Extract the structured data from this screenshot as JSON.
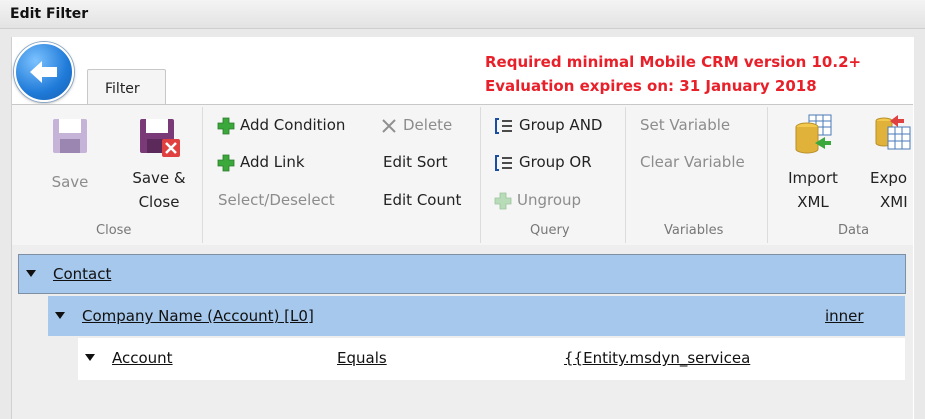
{
  "window": {
    "title": "Edit Filter"
  },
  "tabs": [
    {
      "label": "Filter"
    }
  ],
  "notice": {
    "line1": "Required minimal Mobile CRM version 10.2+",
    "line2": "Evaluation expires on: 31 January 2018"
  },
  "ribbon": {
    "close_group": {
      "label": "Close",
      "save": "Save",
      "save_close_line1": "Save &",
      "save_close_line2": "Close"
    },
    "edit_group": {
      "add_condition": "Add Condition",
      "delete": "Delete",
      "add_link": "Add Link",
      "edit_sort": "Edit Sort",
      "select_deselect": "Select/Deselect",
      "edit_count": "Edit Count"
    },
    "query_group": {
      "label": "Query",
      "group_and": "Group AND",
      "group_or": "Group OR",
      "ungroup": "Ungroup"
    },
    "variables_group": {
      "label": "Variables",
      "set_variable": "Set Variable",
      "clear_variable": "Clear Variable"
    },
    "data_group": {
      "label": "Data",
      "import_line1": "Import",
      "import_line2": "XML",
      "export_line1": "Expo",
      "export_line2": "XMI"
    }
  },
  "tree": {
    "root": {
      "label": "Contact"
    },
    "link": {
      "label": "Company Name (Account) [L0]",
      "join": "inner"
    },
    "condition": {
      "field": "Account",
      "operator": "Equals",
      "value": "{{Entity.msdyn_servicea"
    }
  },
  "colors": {
    "notice": "#e8202a",
    "row_selected": "#a6c8ec",
    "accent_blue": "#1f7ad8"
  }
}
